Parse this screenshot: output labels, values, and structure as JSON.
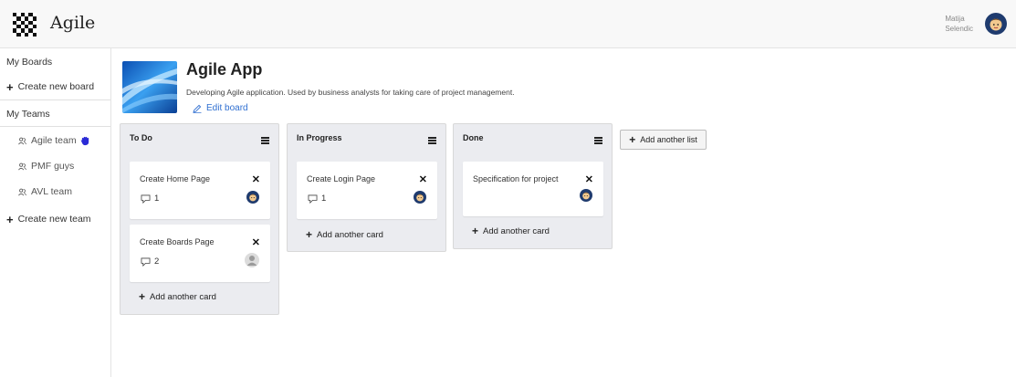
{
  "app": {
    "title": "Agile"
  },
  "user": {
    "first_name": "Matija",
    "last_name": "Selendic"
  },
  "sidebar": {
    "my_boards": "My Boards",
    "create_board": "Create new board",
    "my_teams": "My Teams",
    "teams": [
      {
        "name": "Agile team",
        "icon": "team-icon",
        "active_marker": "hand-icon"
      },
      {
        "name": "PMF guys",
        "icon": "team-icon"
      },
      {
        "name": "AVL team",
        "icon": "team-icon"
      }
    ],
    "create_team": "Create new team"
  },
  "board": {
    "title": "Agile App",
    "description": "Developing Agile application. Used by business analysts for taking care of project management.",
    "edit_label": "Edit board"
  },
  "lists": [
    {
      "title": "To Do",
      "cards": [
        {
          "title": "Create Home Page",
          "comments": "1",
          "assignee": "avatar-face"
        },
        {
          "title": "Create Boards Page",
          "comments": "2",
          "assignee": "avatar-default"
        }
      ],
      "add_card_label": "Add another card"
    },
    {
      "title": "In Progress",
      "cards": [
        {
          "title": "Create Login Page",
          "comments": "1",
          "assignee": "avatar-face"
        }
      ],
      "add_card_label": "Add another card"
    },
    {
      "title": "Done",
      "cards": [
        {
          "title": "Specification for project",
          "comments": "",
          "assignee": "avatar-face"
        }
      ],
      "add_card_label": "Add another card"
    }
  ],
  "add_list_label": "Add another list",
  "colors": {
    "link": "#2f6fd1",
    "list_bg": "#ebecf0",
    "avatar_bg": "#1f3b6e",
    "hand": "#2a2ad6"
  }
}
